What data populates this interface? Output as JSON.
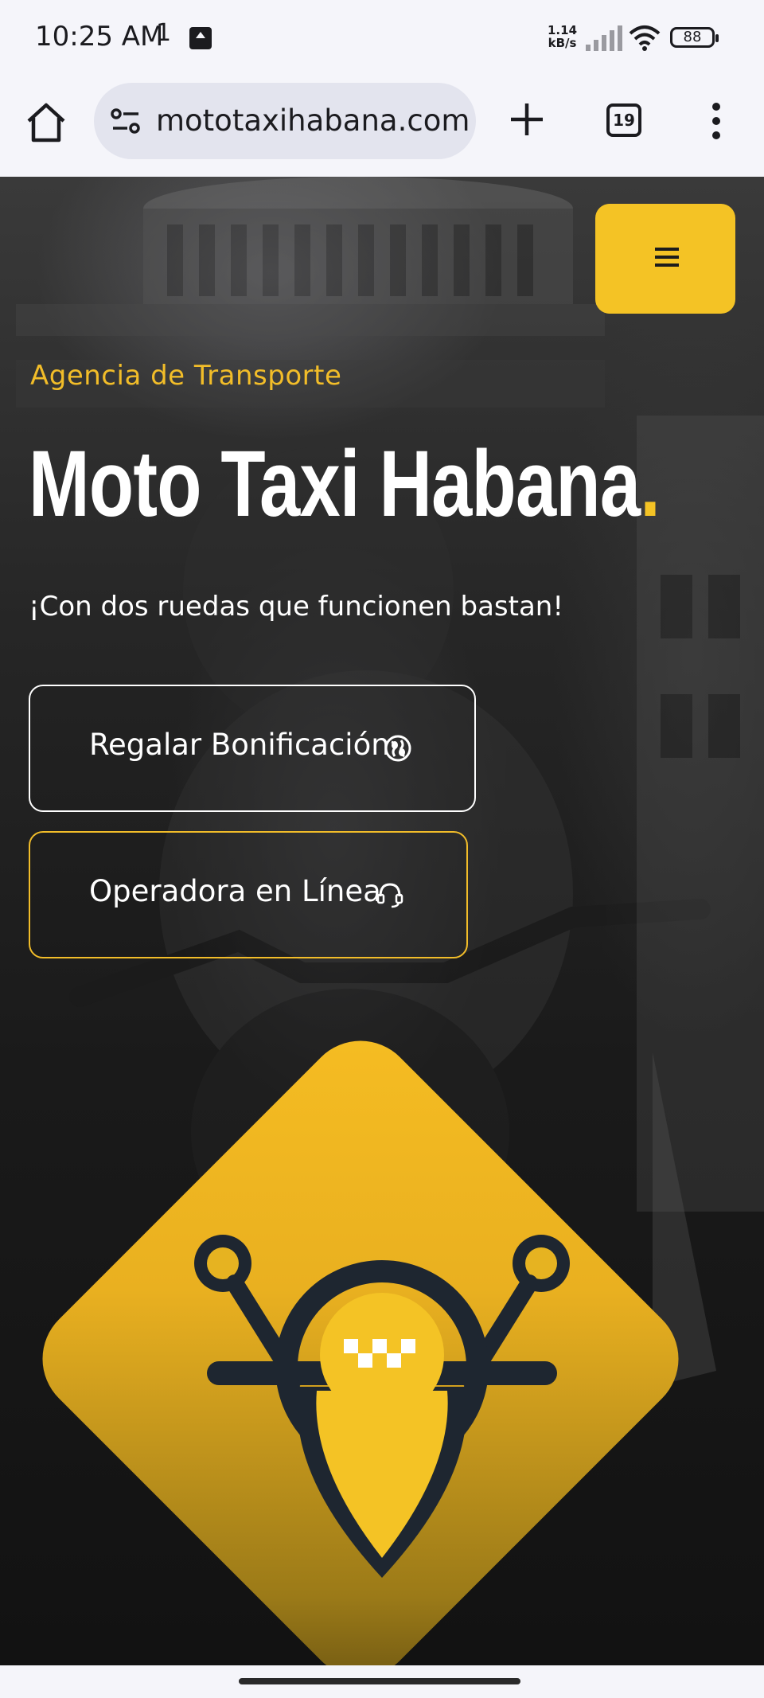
{
  "status_bar": {
    "time": "10:25 AM",
    "extra": "1",
    "network_speed_value": "1.14",
    "network_speed_unit": "kB/s",
    "battery": "88"
  },
  "browser": {
    "url": "mototaxihabana.com",
    "tab_count": "19"
  },
  "hero": {
    "tagline": "Agencia de Transporte",
    "title": "Moto Taxi Habana",
    "title_dot": ".",
    "subtitle": "¡Con dos ruedas que funcionen bastan!",
    "buttons": [
      {
        "label": "Regalar Bonificación",
        "icon": "globe-icon"
      },
      {
        "label": "Operadora en Línea",
        "icon": "headset-icon"
      }
    ]
  },
  "colors": {
    "accent": "#f4c325",
    "logo_dark": "#1e2630"
  }
}
